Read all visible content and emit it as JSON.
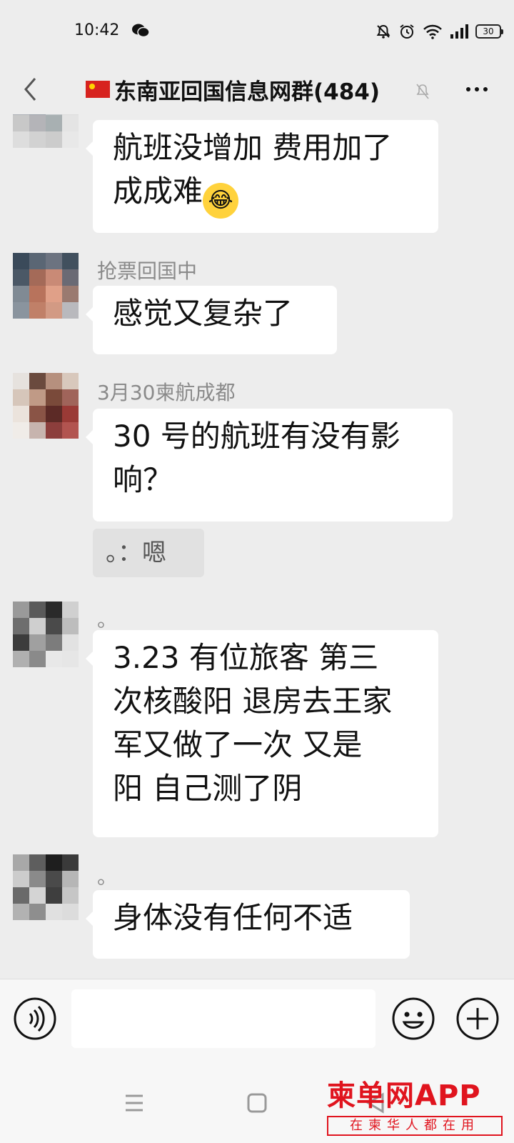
{
  "status_bar": {
    "time": "10:42",
    "battery": "30"
  },
  "header": {
    "title": "东南亚回国信息网群(484)"
  },
  "messages": [
    {
      "sender": "",
      "lines": [
        "航班没增加 费用加了",
        "成成难"
      ],
      "emoji": "😂"
    },
    {
      "sender": "抢票回国中",
      "lines": [
        "感觉又复杂了"
      ]
    },
    {
      "sender": "3月30柬航成都",
      "lines": [
        "30 号的航班有没有影",
        "响？"
      ]
    },
    {
      "quote": "。：嗯"
    },
    {
      "sender": "。",
      "lines": [
        "3.23 有位旅客 第三",
        "次核酸阳 退房去王家",
        "军又做了一次 又是",
        "阳 自己测了阴"
      ]
    },
    {
      "sender": "。",
      "lines": [
        "身体没有任何不适"
      ]
    }
  ],
  "input": {
    "placeholder": ""
  },
  "watermark": {
    "logo": "柬单网APP",
    "tagline": "在柬华人都在用"
  },
  "colors": {
    "background": "#ededed",
    "bubble": "#ffffff",
    "brand_red": "#e0141e"
  }
}
